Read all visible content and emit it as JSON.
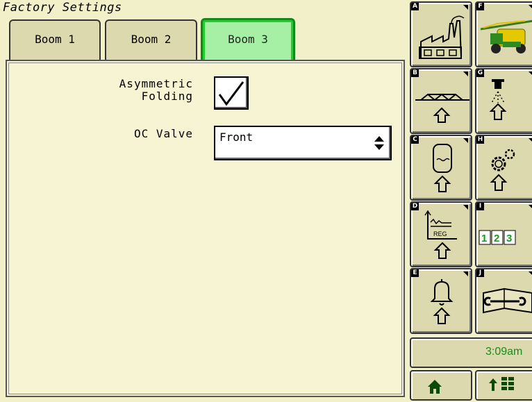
{
  "page": {
    "title": "Factory Settings"
  },
  "tabs": [
    {
      "label": "Boom 1",
      "active": false
    },
    {
      "label": "Boom 2",
      "active": false
    },
    {
      "label": "Boom 3",
      "active": true
    }
  ],
  "form": {
    "asymmetric_folding": {
      "label": "Asymmetric\nFolding",
      "checked": true
    },
    "oc_valve": {
      "label": "OC Valve",
      "value": "Front"
    }
  },
  "sidebar": {
    "buttons": [
      {
        "letter": "A",
        "icon": "factory-icon"
      },
      {
        "letter": "F",
        "icon": "sprayer-machine-icon"
      },
      {
        "letter": "B",
        "icon": "boom-icon"
      },
      {
        "letter": "G",
        "icon": "nozzle-spray-icon"
      },
      {
        "letter": "C",
        "icon": "tank-icon"
      },
      {
        "letter": "H",
        "icon": "gears-icon"
      },
      {
        "letter": "D",
        "icon": "reg-chart-icon",
        "icon_text": "REG"
      },
      {
        "letter": "I",
        "icon": "section-numbers-icon",
        "icon_text": [
          "1",
          "2",
          "3"
        ]
      },
      {
        "letter": "E",
        "icon": "alarm-bell-icon"
      },
      {
        "letter": "J",
        "icon": "manual-wrench-icon"
      }
    ],
    "time": "3:09am",
    "home_icon": "home-icon",
    "menu_icon": "up-arrow-grid-icon"
  },
  "colors": {
    "background": "#f2f0c8",
    "button": "#ddd9ae",
    "active_tab": "#22cc2c",
    "time_text": "#1a8a1a"
  }
}
